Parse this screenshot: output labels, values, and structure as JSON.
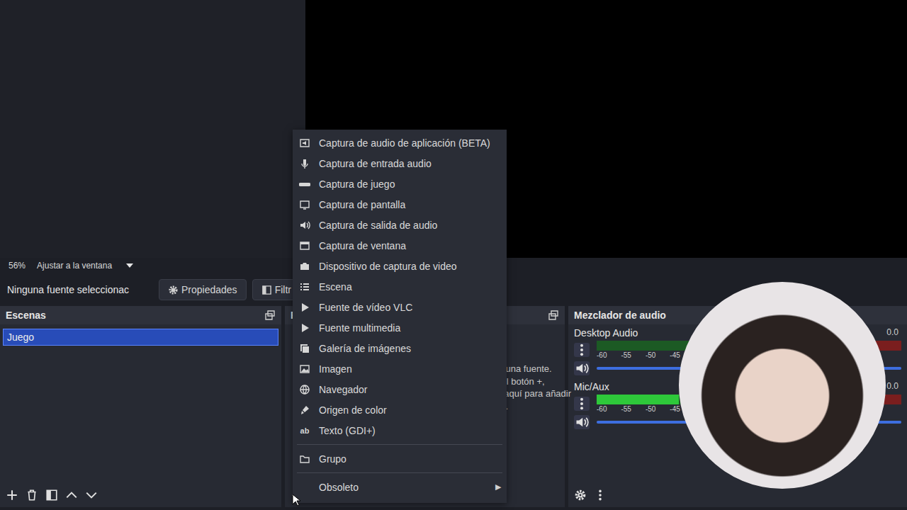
{
  "preview": {
    "zoom": "56%",
    "fit": "Ajustar a la ventana"
  },
  "context_bar": {
    "status": "Ninguna fuente seleccionac",
    "properties": "Propiedades",
    "filters": "Filtr"
  },
  "scenes": {
    "title": "Escenas",
    "items": [
      {
        "label": "Juego",
        "selected": true
      }
    ]
  },
  "sources": {
    "title": "Fuentes",
    "empty_icon": "?",
    "empty_lines": [
      "No tienes ninguna fuente.",
      "Haz clic en el botón +,",
      "o haz clic derecho aquí para añadir",
      "una."
    ]
  },
  "mixer": {
    "title": "Mezclador de audio",
    "channels": [
      {
        "name": "Desktop Audio",
        "level": 0,
        "volume": 1,
        "reading": "0.0",
        "muted": false
      },
      {
        "name": "Mic/Aux",
        "level": 0.27,
        "volume": 1,
        "reading": "0.0",
        "muted": false
      }
    ],
    "scale": [
      "-60",
      "-55",
      "-50",
      "-45"
    ]
  },
  "menu": {
    "items": [
      {
        "kind": "item",
        "label": "Captura de audio de aplicación (BETA)"
      },
      {
        "kind": "item",
        "label": "Captura de entrada audio"
      },
      {
        "kind": "item",
        "label": "Captura de juego"
      },
      {
        "kind": "item",
        "label": "Captura de pantalla"
      },
      {
        "kind": "item",
        "label": "Captura de salida de audio"
      },
      {
        "kind": "item",
        "label": "Captura de ventana"
      },
      {
        "kind": "item",
        "label": "Dispositivo de captura de video"
      },
      {
        "kind": "item",
        "label": "Escena"
      },
      {
        "kind": "item",
        "label": "Fuente de vídeo VLC"
      },
      {
        "kind": "item",
        "label": "Fuente multimedia"
      },
      {
        "kind": "item",
        "label": "Galería de imágenes"
      },
      {
        "kind": "item",
        "label": "Imagen"
      },
      {
        "kind": "item",
        "label": "Navegador"
      },
      {
        "kind": "item",
        "label": "Origen de color"
      },
      {
        "kind": "item",
        "label": "Texto (GDI+)",
        "icon_text": "ab"
      },
      {
        "kind": "separator"
      },
      {
        "kind": "item",
        "label": "Grupo"
      },
      {
        "kind": "separator"
      },
      {
        "kind": "item",
        "label": "Obsoleto",
        "submenu": "▶"
      }
    ]
  }
}
